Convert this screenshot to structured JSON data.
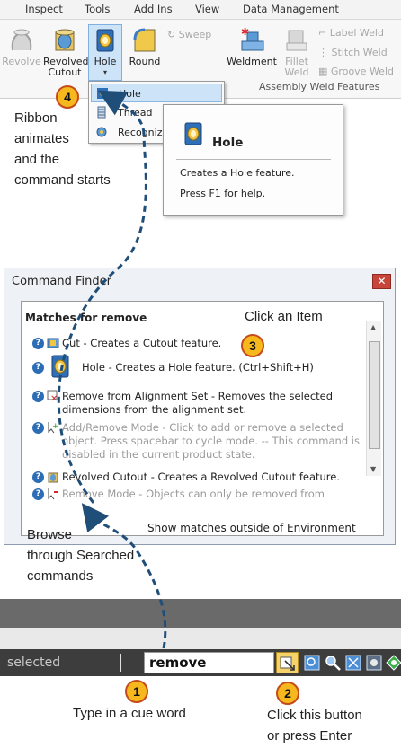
{
  "menu": [
    "Inspect",
    "Tools",
    "Add Ins",
    "View",
    "Data Management"
  ],
  "ribbon": {
    "revolve": "Revolve",
    "revolved_cutout_line1": "Revolved",
    "revolved_cutout_line2": "Cutout",
    "hole": "Hole",
    "round": "Round",
    "sweep": "Sweep",
    "weldment": "Weldment",
    "fillet_weld_line1": "Fillet",
    "fillet_weld_line2": "Weld",
    "label_weld": "Label Weld",
    "stitch_weld": "Stitch Weld",
    "groove_weld": "Groove Weld",
    "group_label": "Assembly Weld Features"
  },
  "dropdown": {
    "items": [
      "Hole",
      "Thread",
      "Recognize"
    ]
  },
  "tooltip": {
    "title": "Hole",
    "description": "Creates a Hole feature.",
    "help": "Press F1 for help."
  },
  "annotations": {
    "ribbon_note": [
      "Ribbon",
      "animates",
      "and the",
      "command starts"
    ],
    "browse_note": [
      "Browse",
      "through Searched",
      "commands"
    ],
    "cue_note": "Type in a cue word",
    "click_note": [
      "Click this button",
      "or press Enter"
    ],
    "badges": [
      "1",
      "2",
      "3",
      "4"
    ]
  },
  "finder": {
    "title": "Command Finder",
    "close": "✕",
    "matches_label": "Matches for  remove",
    "click_item": "Click an Item",
    "items": [
      {
        "text": "Cut - Creates a Cutout feature.",
        "disabled": false
      },
      {
        "text": "Hole - Creates a Hole feature. (Ctrl+Shift+H)",
        "disabled": false
      },
      {
        "text": "Remove from Alignment Set - Removes the selected dimensions from the alignment set.",
        "disabled": false
      },
      {
        "text": "Add/Remove Mode - Click to add or remove a selected object. Press spacebar to cycle mode. -- This command is disabled in the current product state.",
        "disabled": true
      },
      {
        "text": "Revolved Cutout - Creates a Revolved Cutout feature.",
        "disabled": false
      },
      {
        "text": "Remove Mode - Objects can only be removed from",
        "disabled": true
      }
    ],
    "show_matches": "Show matches outside of Environment"
  },
  "statusbar": {
    "status_text": "selected",
    "command_value": "remove"
  },
  "colors": {
    "badge_fill": "#f6b81c",
    "badge_border": "#c64b1a",
    "arrow": "#1f4e79",
    "highlight": "#cde3f7"
  }
}
